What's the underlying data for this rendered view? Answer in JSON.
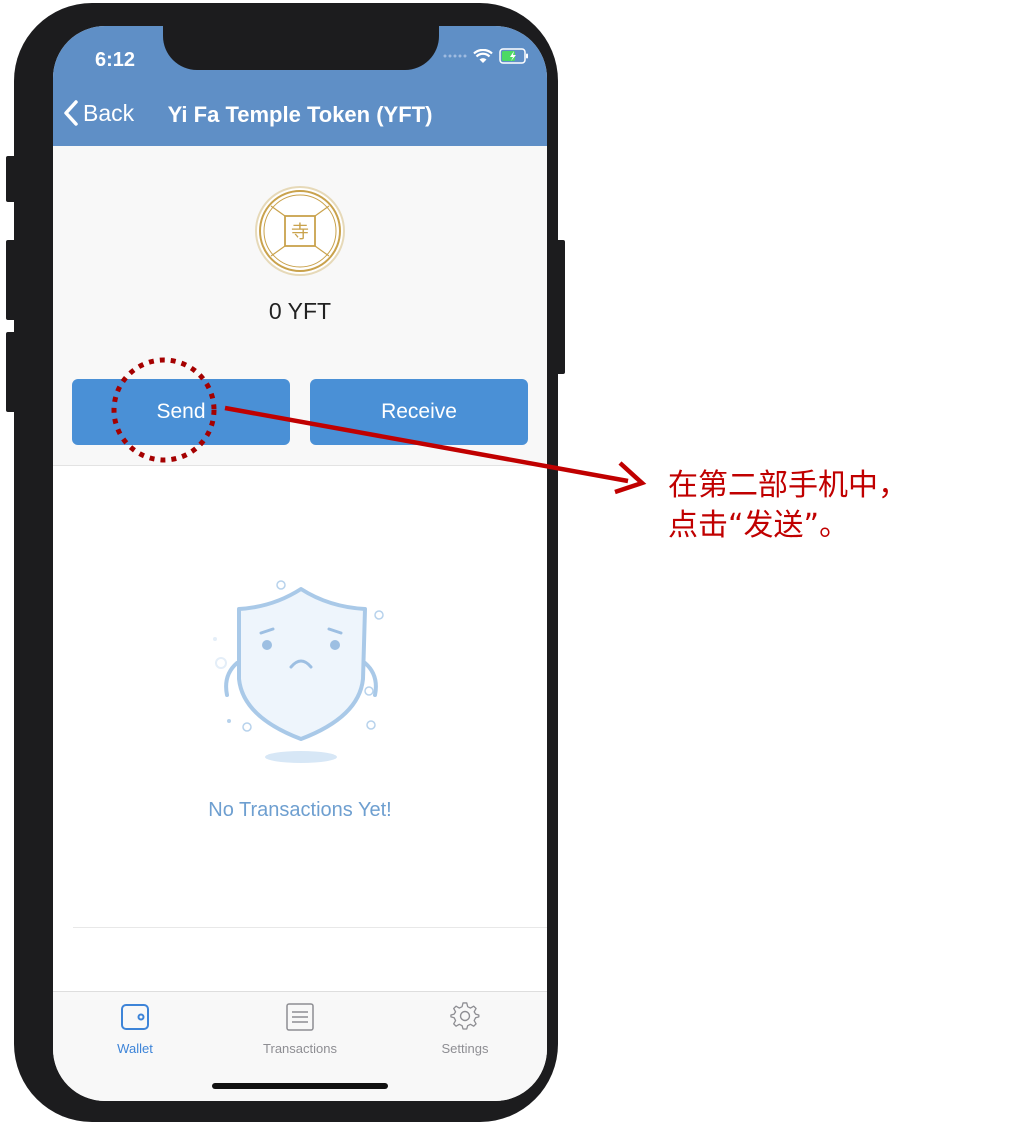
{
  "status_bar": {
    "time": "6:12"
  },
  "nav": {
    "back_label": "Back",
    "title": "Yi Fa Temple Token (YFT)"
  },
  "token": {
    "icon": "temple-coin-icon",
    "balance": "0 YFT"
  },
  "actions": {
    "send_label": "Send",
    "receive_label": "Receive"
  },
  "transactions": {
    "empty_icon": "sad-shield-icon",
    "empty_message": "No Transactions Yet!"
  },
  "tabbar": {
    "items": [
      {
        "label": "Wallet",
        "icon": "wallet-icon",
        "active": true
      },
      {
        "label": "Transactions",
        "icon": "list-icon",
        "active": false
      },
      {
        "label": "Settings",
        "icon": "gear-icon",
        "active": false
      }
    ]
  },
  "annotation": {
    "line1": "在第二部手机中，",
    "line2": "点击“发送”。"
  },
  "colors": {
    "nav_bar": "#5f8fc6",
    "button": "#4a90d6",
    "active_tab": "#3d84d8",
    "empty_text": "#6e9fd0",
    "annotation": "#c00000"
  }
}
